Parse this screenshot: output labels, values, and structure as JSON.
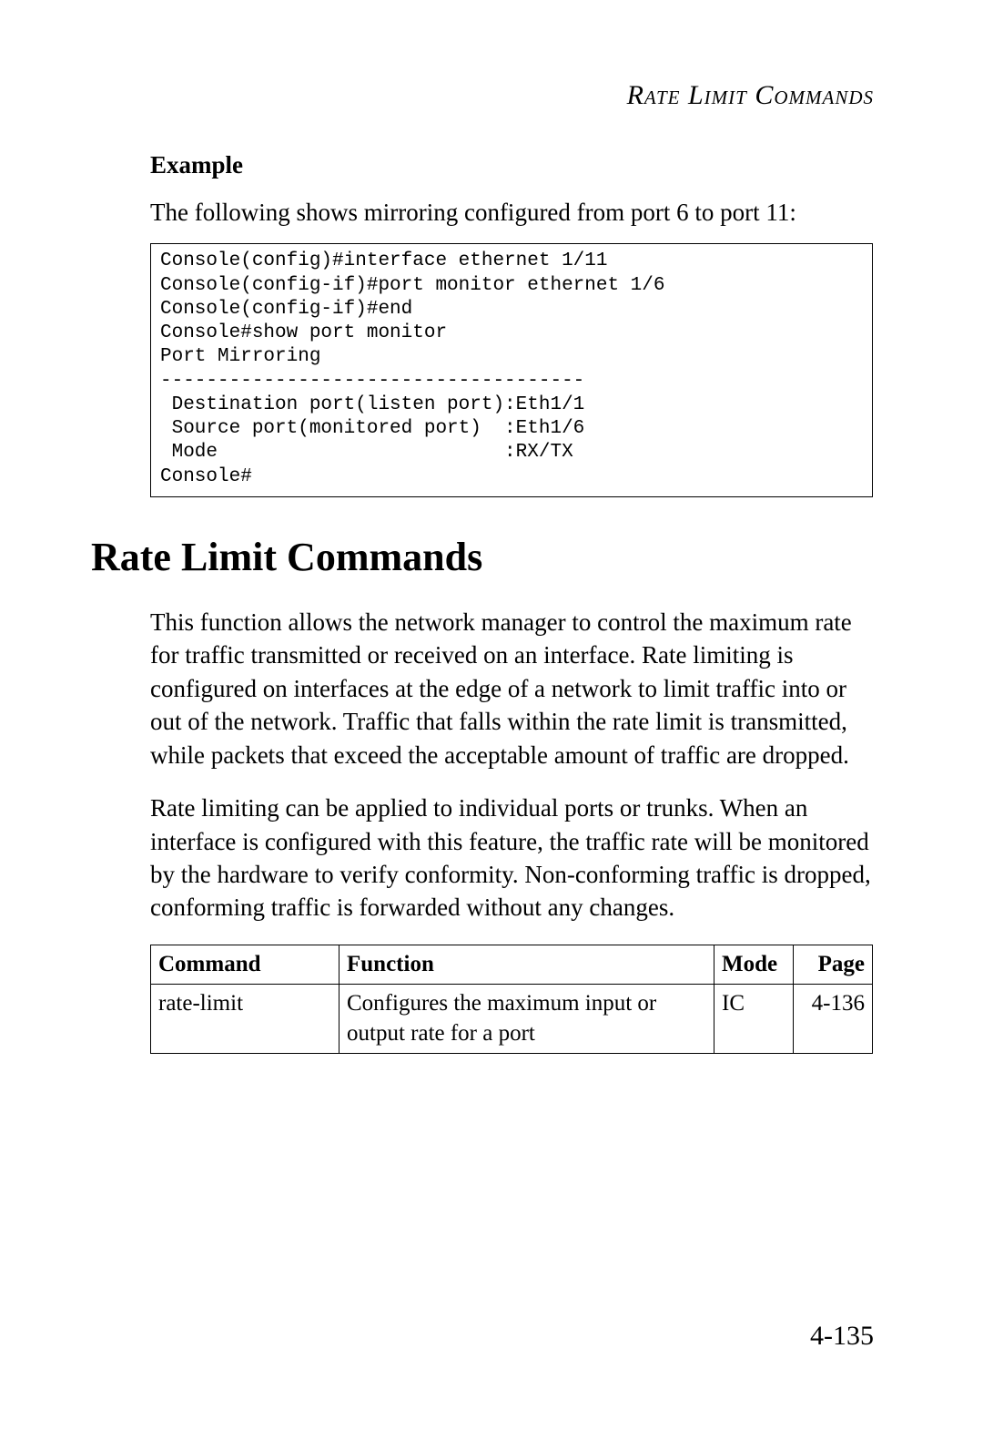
{
  "running_head": "Rate Limit Commands",
  "example": {
    "heading": "Example",
    "intro": "The following shows mirroring configured from port 6 to port 11:",
    "code": "Console(config)#interface ethernet 1/11\nConsole(config-if)#port monitor ethernet 1/6\nConsole(config-if)#end\nConsole#show port monitor\nPort Mirroring\n-------------------------------------\n Destination port(listen port):Eth1/1\n Source port(monitored port)  :Eth1/6\n Mode                         :RX/TX\nConsole#"
  },
  "section": {
    "title": "Rate Limit Commands",
    "para1": "This function allows the network manager to control the maximum rate for traffic transmitted or received on an interface. Rate limiting is configured on interfaces at the edge of a network to limit traffic into or out of the network. Traffic that falls within the rate limit is transmitted, while packets that exceed the acceptable amount of traffic are dropped.",
    "para2": "Rate limiting can be applied to individual ports or trunks. When an interface is configured with this feature, the traffic rate will be monitored by the hardware to verify conformity. Non-conforming traffic is dropped, conforming traffic is forwarded without any changes."
  },
  "table": {
    "headers": {
      "command": "Command",
      "function": "Function",
      "mode": "Mode",
      "page": "Page"
    },
    "rows": [
      {
        "command": "rate-limit",
        "function": "Configures the maximum input or output rate for a port",
        "mode": "IC",
        "page": "4-136"
      }
    ]
  },
  "page_number": "4-135"
}
